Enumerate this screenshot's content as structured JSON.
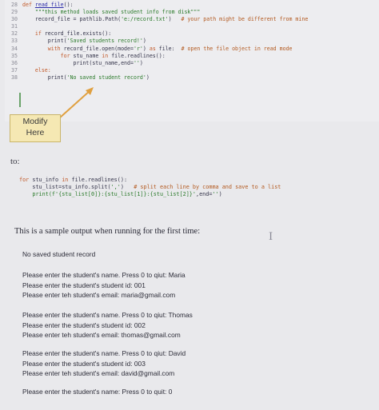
{
  "top_code": {
    "line_numbers": [
      "28",
      "29",
      "30",
      "31",
      "32",
      "33",
      "34",
      "35",
      "36",
      "37",
      "38"
    ],
    "lines": [
      [
        {
          "t": "def ",
          "c": "kw"
        },
        {
          "t": "read_file",
          "c": "fn"
        },
        {
          "t": "():",
          "c": ""
        }
      ],
      [
        {
          "t": "    \"\"\"this method loads saved student info from disk\"\"\"",
          "c": "str"
        }
      ],
      [
        {
          "t": "    record_file = pathlib.Path(",
          "c": ""
        },
        {
          "t": "'e:/record.txt'",
          "c": "str"
        },
        {
          "t": ")   ",
          "c": ""
        },
        {
          "t": "# your path might be different from mine",
          "c": "cm"
        }
      ],
      [
        {
          "t": "",
          "c": ""
        }
      ],
      [
        {
          "t": "    ",
          "c": ""
        },
        {
          "t": "if",
          "c": "kw"
        },
        {
          "t": " record_file.exists():",
          "c": ""
        }
      ],
      [
        {
          "t": "        print(",
          "c": ""
        },
        {
          "t": "'Saved students record!'",
          "c": "str"
        },
        {
          "t": ")",
          "c": ""
        }
      ],
      [
        {
          "t": "        ",
          "c": ""
        },
        {
          "t": "with",
          "c": "kw"
        },
        {
          "t": " record_file.open(mode=",
          "c": ""
        },
        {
          "t": "'r'",
          "c": "str"
        },
        {
          "t": ") ",
          "c": ""
        },
        {
          "t": "as",
          "c": "kw"
        },
        {
          "t": " file:  ",
          "c": ""
        },
        {
          "t": "# open the file object in read mode",
          "c": "cm"
        }
      ],
      [
        {
          "t": "            ",
          "c": ""
        },
        {
          "t": "for",
          "c": "kw"
        },
        {
          "t": " stu_name ",
          "c": ""
        },
        {
          "t": "in",
          "c": "kw"
        },
        {
          "t": " file.readlines():",
          "c": ""
        }
      ],
      [
        {
          "t": "                print(stu_name,end=",
          "c": ""
        },
        {
          "t": "''",
          "c": "str"
        },
        {
          "t": ")",
          "c": ""
        }
      ],
      [
        {
          "t": "    ",
          "c": ""
        },
        {
          "t": "else:",
          "c": "kw"
        }
      ],
      [
        {
          "t": "        print(",
          "c": ""
        },
        {
          "t": "'No saved student record'",
          "c": "str"
        },
        {
          "t": ")",
          "c": ""
        }
      ]
    ]
  },
  "annotation": {
    "line1": "Modify",
    "line2": "Here"
  },
  "to_label": "to:",
  "mid_code": {
    "lines": [
      [
        {
          "t": "for",
          "c": "kw"
        },
        {
          "t": " stu_info ",
          "c": ""
        },
        {
          "t": "in",
          "c": "kw"
        },
        {
          "t": " file.readlines():",
          "c": ""
        }
      ],
      [
        {
          "t": "    stu_list=stu_info.split(",
          "c": ""
        },
        {
          "t": "','",
          "c": "str"
        },
        {
          "t": ")   ",
          "c": ""
        },
        {
          "t": "# split each line by comma and save to a list",
          "c": "cm"
        }
      ],
      [
        {
          "t": "    print(f'{stu_list[0]}:{stu_list[1]}:{stu_list[2]}'",
          "c": "str"
        },
        {
          "t": ",end=",
          "c": ""
        },
        {
          "t": "''",
          "c": "str"
        },
        {
          "t": ")",
          "c": ""
        }
      ]
    ]
  },
  "sample_intro": "This is a sample output when running for the first time:",
  "output_blocks": [
    [
      "No saved student record"
    ],
    [
      "Please enter the student's name. Press 0 to qiut: Maria",
      "Please enter the student's student id: 001",
      "Please enter teh student's email: maria@gmail.com"
    ],
    [
      "Please enter the student's name. Press 0 to qiut: Thomas",
      "Please enter the student's student id: 002",
      "Please enter teh student's email: thomas@gmail.com"
    ],
    [
      "Please enter the student's name. Press 0 to qiut: David",
      "Please enter the student's student id: 003",
      "Please enter teh student's email: david@gmail.com"
    ],
    [
      "Please enter the student's name: Press 0 to quit: 0"
    ]
  ],
  "colors": {
    "annotation_bg": "#f5e8b3",
    "arrow": "#e0a040",
    "keyword": "#c25a2a",
    "string": "#2a7a2a",
    "comment": "#b3591f"
  }
}
